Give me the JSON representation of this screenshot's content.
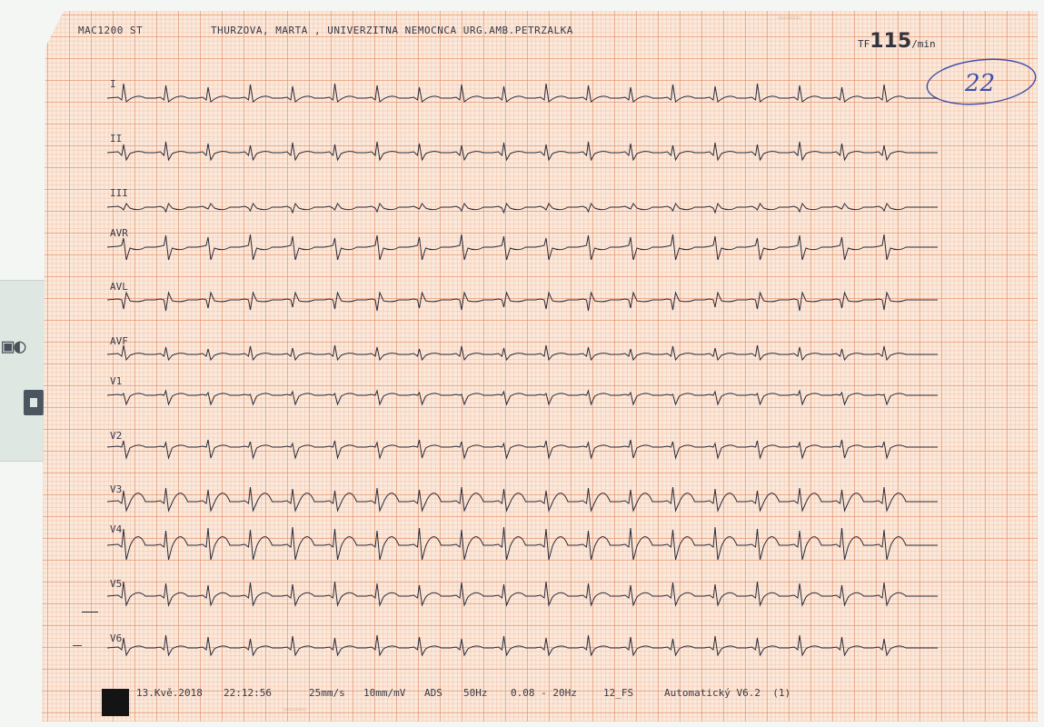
{
  "header": {
    "device": "MAC1200 ST",
    "patient_line": "THURZOVA, MARTA , UNIVERZITNA NEMOCNCA URG.AMB.PETRZALKA",
    "heart_rate": {
      "prefix": "TF",
      "value": "115",
      "unit": "/min"
    }
  },
  "handwritten_note": "22",
  "leads": [
    "I",
    "II",
    "III",
    "AVR",
    "AVL",
    "AVF",
    "V1",
    "V2",
    "V3",
    "V4",
    "V5",
    "V6"
  ],
  "footer": {
    "date": "13.Kvě.2018",
    "time": "22:12:56",
    "speed": "25mm/s",
    "gain": "10mm/mV",
    "ads": "ADS",
    "mains": "50Hz",
    "filter": "0.08 - 20Hz",
    "lead_format": "12_FS",
    "analysis": "Automatický V6.2  (1)"
  },
  "colors": {
    "paper": "#fbe9dc",
    "grid": "#e28c64",
    "trace": "#2b2b3a",
    "ink": "#3f4fa8"
  }
}
